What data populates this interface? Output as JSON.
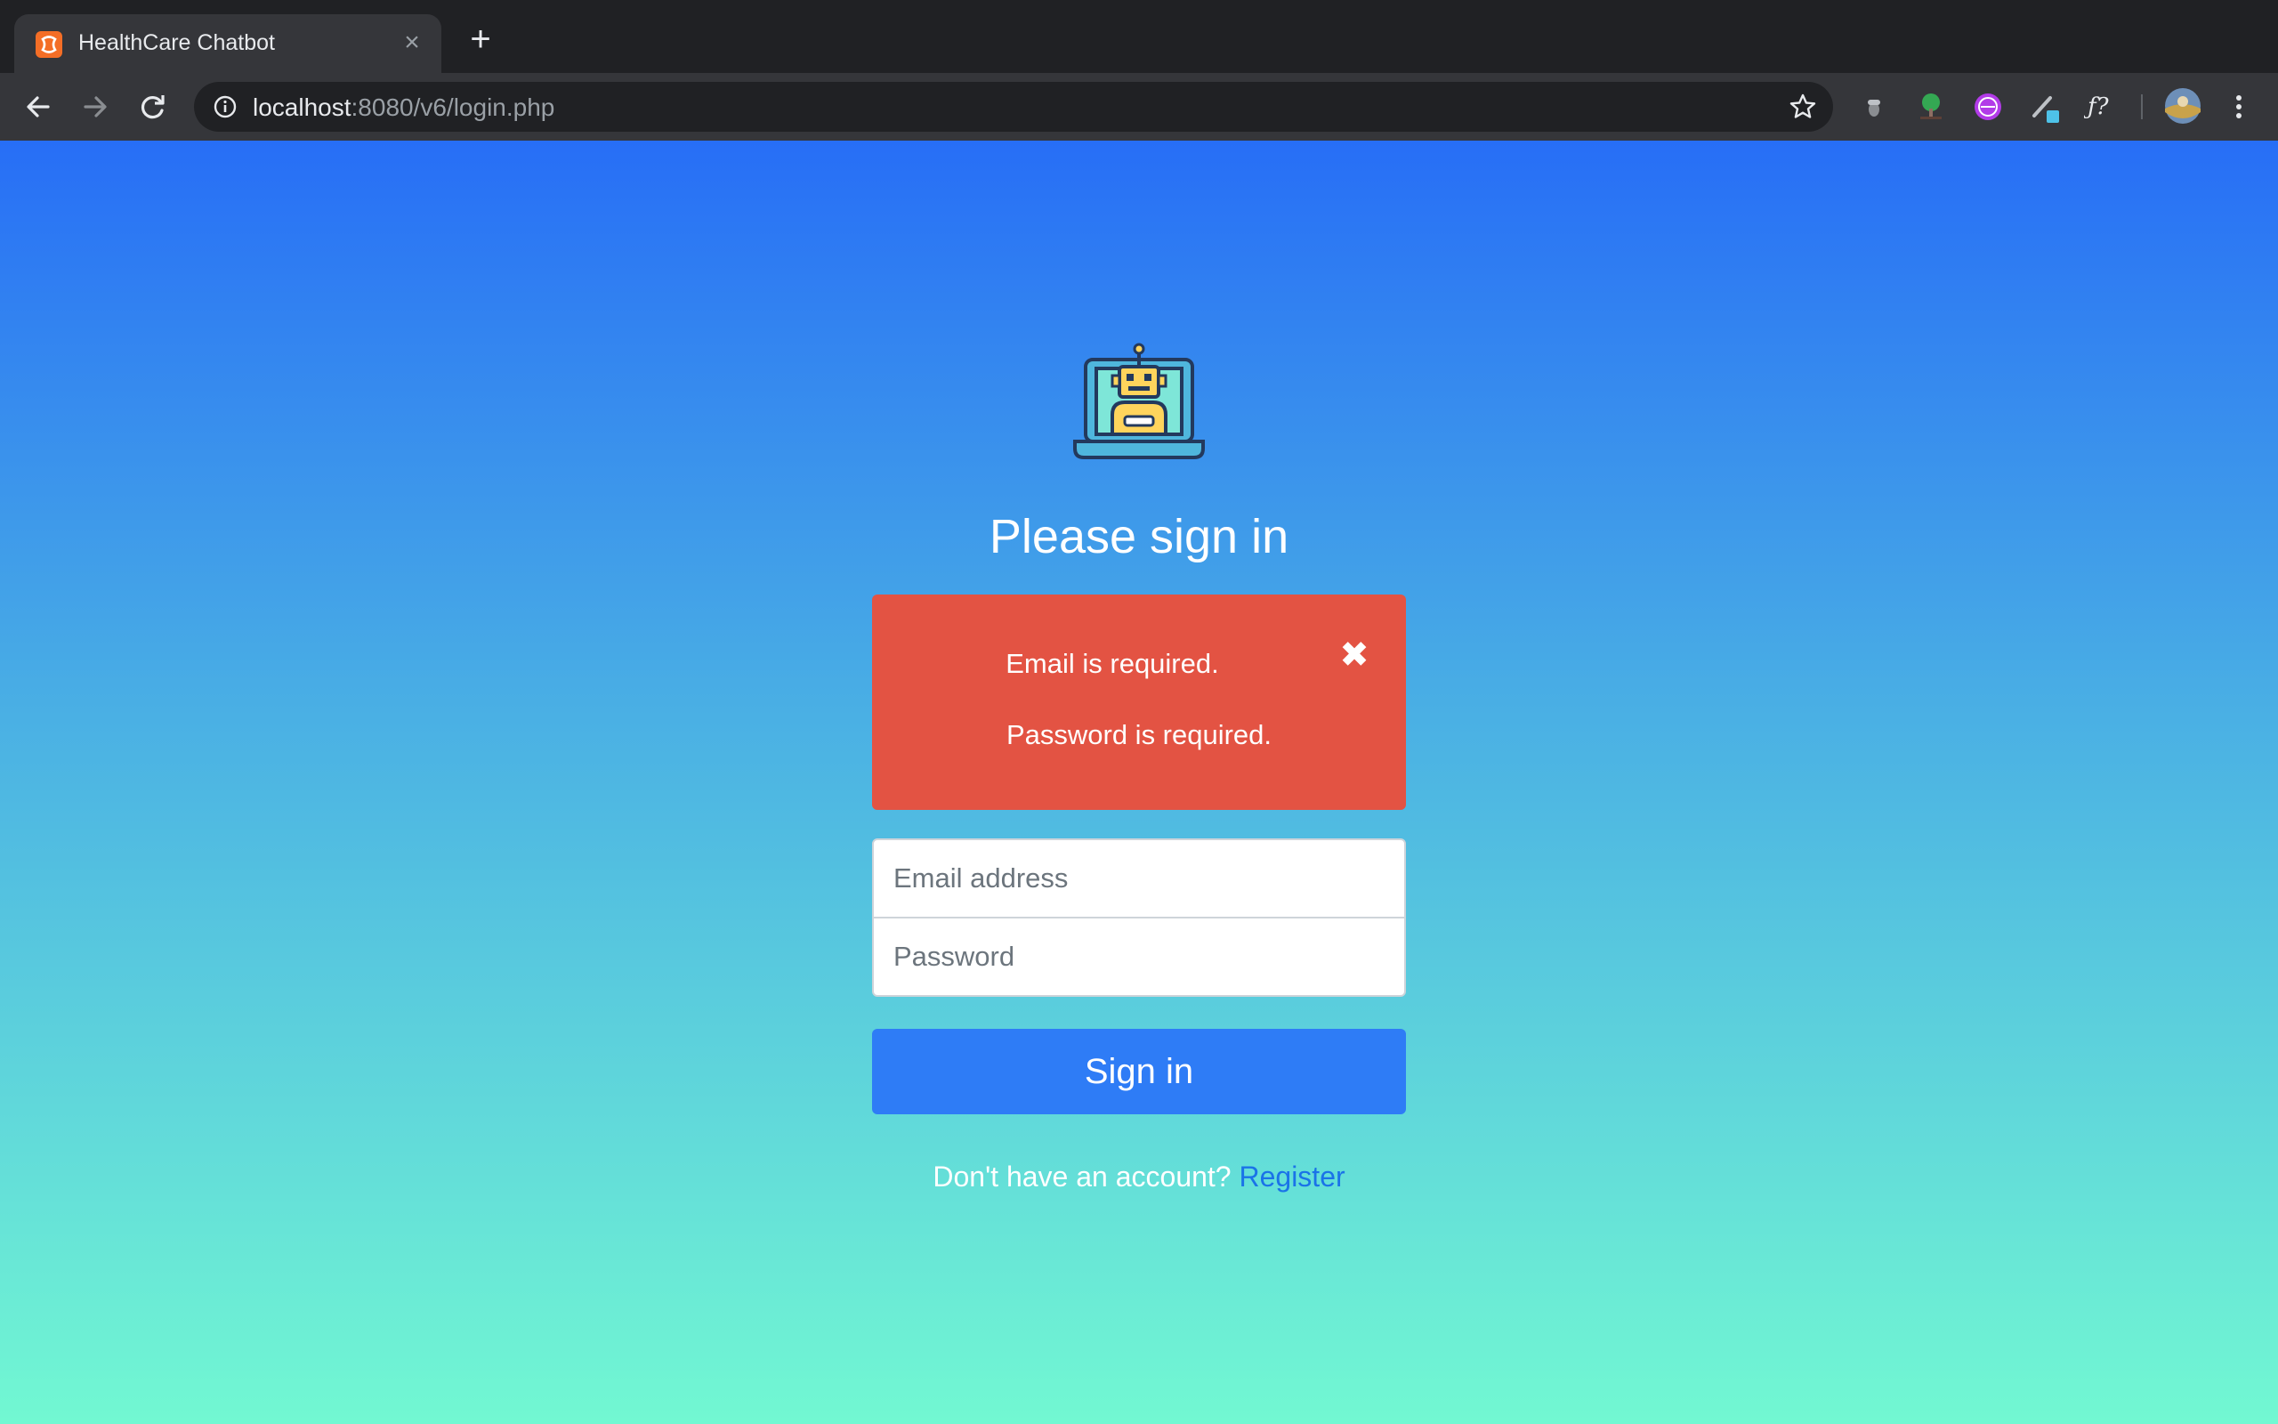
{
  "browser": {
    "tab": {
      "title": "HealthCare Chatbot",
      "close_glyph": "×",
      "favicon": "xampp-icon"
    },
    "new_tab_glyph": "+",
    "address": {
      "host": "localhost",
      "rest": ":8080/v6/login.php"
    },
    "extensions": [
      "acorn-icon",
      "tree-icon",
      "purple-globe-icon",
      "pen-icon",
      "formula-icon",
      "profile-avatar"
    ]
  },
  "login": {
    "heading": "Please sign in",
    "alert": {
      "messages": [
        "Email is required.",
        "Password is required."
      ],
      "close_glyph": "✖",
      "color": "#e35343"
    },
    "email_placeholder": "Email address",
    "password_placeholder": "Password",
    "submit_label": "Sign in",
    "register_prompt": "Don't have an account? ",
    "register_link": "Register"
  },
  "colors": {
    "gradient_top": "#276ef6",
    "gradient_bottom": "#72f8d2",
    "button": "#2e7cf6",
    "link": "#1a73e8"
  }
}
